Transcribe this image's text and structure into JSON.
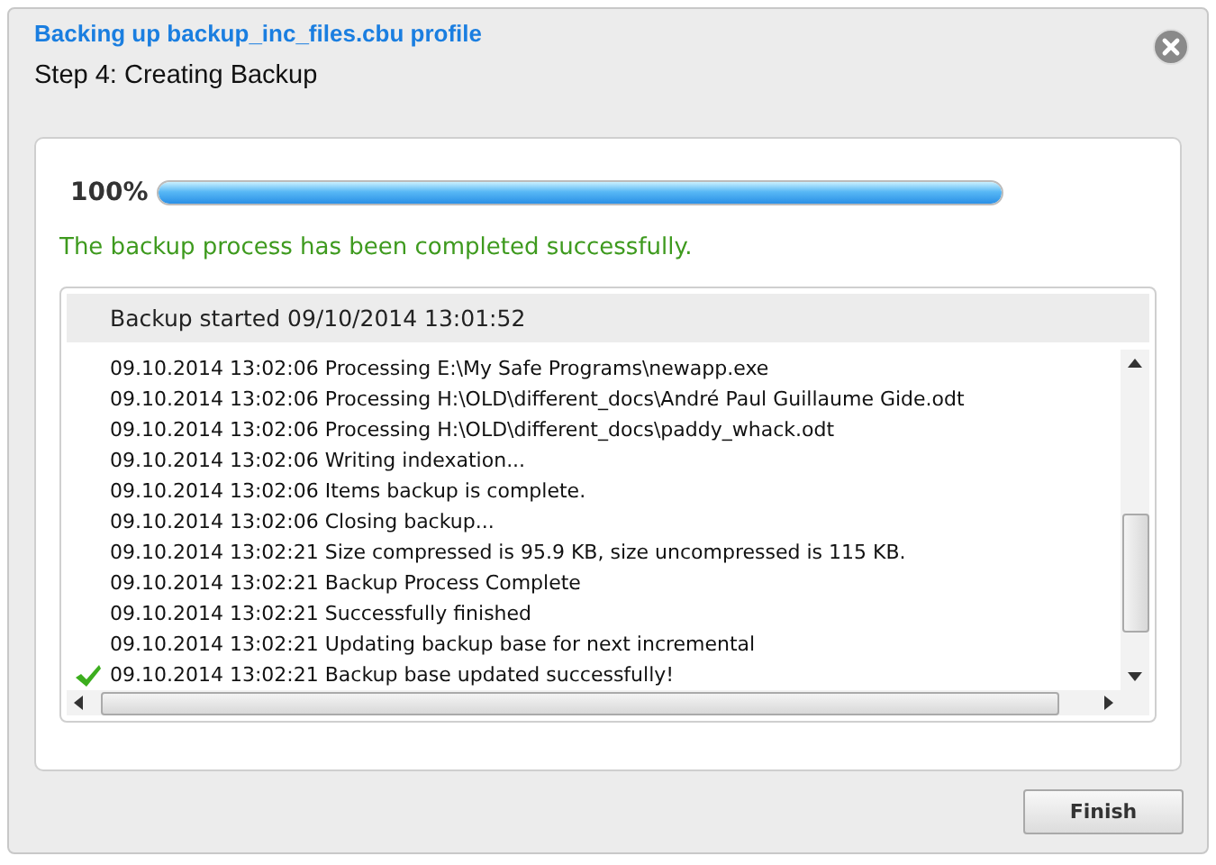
{
  "window": {
    "title": "Backing up backup_inc_files.cbu profile",
    "subtitle": "Step 4: Creating Backup"
  },
  "progress": {
    "label": "100%",
    "level": 1
  },
  "status_message": "The backup process has been completed successfully.",
  "log": {
    "header": "Backup started 09/10/2014 13:01:52",
    "entries": [
      {
        "kind": "info",
        "text": "09.10.2014 13:02:06 Processing E:\\My Safe Programs\\newapp.exe"
      },
      {
        "kind": "info",
        "text": "09.10.2014 13:02:06 Processing H:\\OLD\\different_docs\\André Paul Guillaume Gide.odt"
      },
      {
        "kind": "info",
        "text": "09.10.2014 13:02:06 Processing H:\\OLD\\different_docs\\paddy_whack.odt"
      },
      {
        "kind": "info",
        "text": "09.10.2014 13:02:06 Writing indexation..."
      },
      {
        "kind": "info",
        "text": "09.10.2014 13:02:06 Items backup is complete."
      },
      {
        "kind": "info",
        "text": "09.10.2014 13:02:06 Closing backup..."
      },
      {
        "kind": "info",
        "text": "09.10.2014 13:02:21 Size compressed is 95.9 KB, size uncompressed is 115 KB."
      },
      {
        "kind": "info",
        "text": "09.10.2014 13:02:21 Backup Process Complete"
      },
      {
        "kind": "info",
        "text": "09.10.2014 13:02:21 Successfully finished"
      },
      {
        "kind": "info",
        "text": "09.10.2014 13:02:21 Updating backup base for next incremental"
      },
      {
        "kind": "success",
        "text": "09.10.2014 13:02:21 Backup base updated successfully!"
      }
    ]
  },
  "buttons": [
    "Finish"
  ]
}
